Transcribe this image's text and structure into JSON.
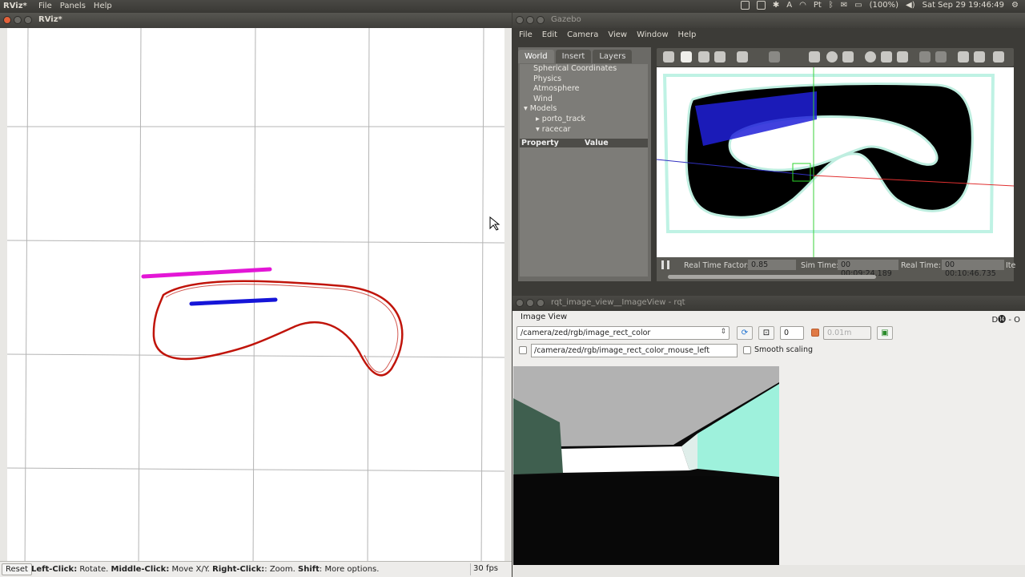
{
  "topbar": {
    "app_name": "RViz*",
    "menu": [
      "File",
      "Panels",
      "Help"
    ],
    "battery": "(100%)",
    "clock": "Sat Sep 29 19:46:49"
  },
  "rviz": {
    "title": "RViz*",
    "status": {
      "reset": "Reset",
      "hint_parts": [
        {
          "b": "Left-Click:",
          "t": " Rotate. "
        },
        {
          "b": "Middle-Click:",
          "t": " Move X/Y. "
        },
        {
          "b": "Right-Click:",
          "t": ": Zoom. "
        },
        {
          "b": "Shift",
          "t": ": More options."
        }
      ],
      "fps": "30 fps"
    },
    "colors": {
      "path_red": "#c0140a",
      "magenta": "#e316d6",
      "blue": "#1515d8"
    }
  },
  "gazebo": {
    "title": "Gazebo",
    "menu": [
      "File",
      "Edit",
      "Camera",
      "View",
      "Window",
      "Help"
    ],
    "tabs": [
      "World",
      "Insert",
      "Layers"
    ],
    "tree": [
      "Spherical Coordinates",
      "Physics",
      "Atmosphere",
      "Wind",
      "Models",
      "porto_track",
      "racecar"
    ],
    "props_header": {
      "property": "Property",
      "value": "Value"
    },
    "bottom": {
      "rtf_label": "Real Time Factor:",
      "rtf_value": "0.85",
      "sim_label": "Sim Time:",
      "sim_value": "00 00:09:24.189",
      "real_label": "Real Time:",
      "real_value": "00 00:10:46.735",
      "iter_label": "Ite"
    }
  },
  "rqt": {
    "title": "rqt_image_view__ImageView - rqt",
    "dock_name": "Image View",
    "dock_controls": "D⓮ - O",
    "topic": "/camera/zed/rgb/image_rect_color",
    "spin_value": "0",
    "spin2_value": "0.01m",
    "mouse_topic": "/camera/zed/rgb/image_rect_color_mouse_left",
    "smooth_label": "Smooth scaling"
  }
}
